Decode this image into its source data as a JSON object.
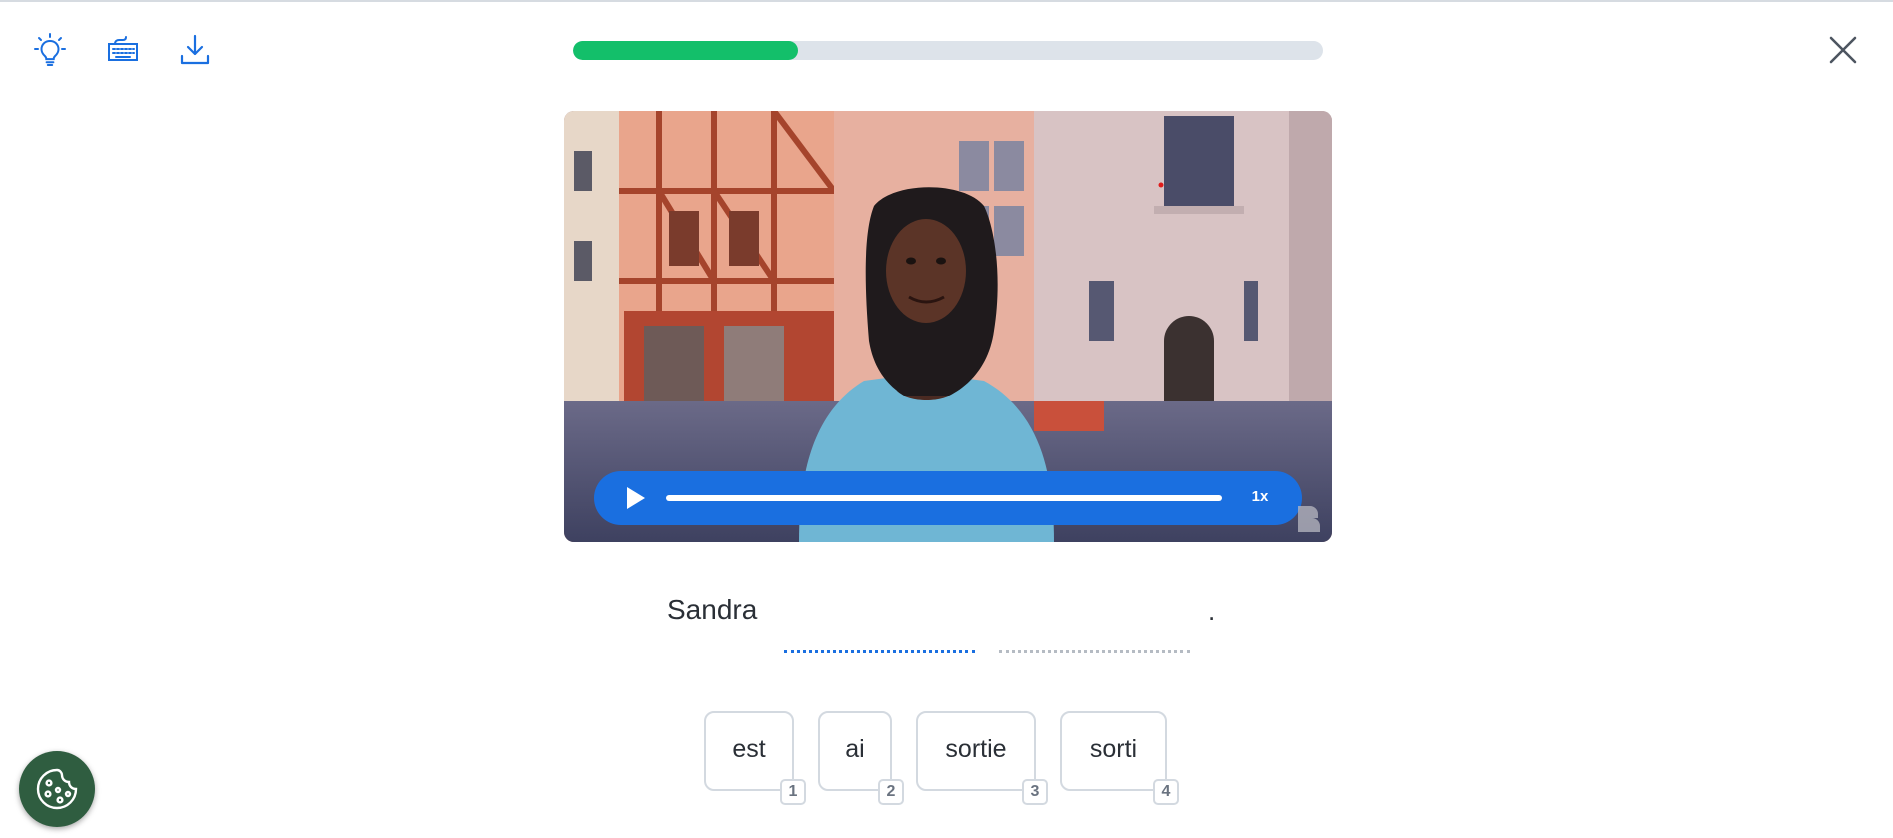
{
  "toolbar": {
    "icons": [
      "lightbulb-icon",
      "keyboard-icon",
      "download-icon"
    ]
  },
  "progress": {
    "fraction": 0.3
  },
  "video": {
    "speed_label": "1x",
    "played_fraction": 0
  },
  "exercise": {
    "prefix": "Sandra",
    "blanks_count": 2,
    "suffix": "."
  },
  "word_bank": [
    {
      "word": "est",
      "key": "1"
    },
    {
      "word": "ai",
      "key": "2"
    },
    {
      "word": "sortie",
      "key": "3"
    },
    {
      "word": "sorti",
      "key": "4"
    }
  ],
  "colors": {
    "accent": "#1a6fe0",
    "progress_fill": "#13bf6a",
    "progress_track": "#dde3ea",
    "cookie_button": "#2f5d40"
  }
}
